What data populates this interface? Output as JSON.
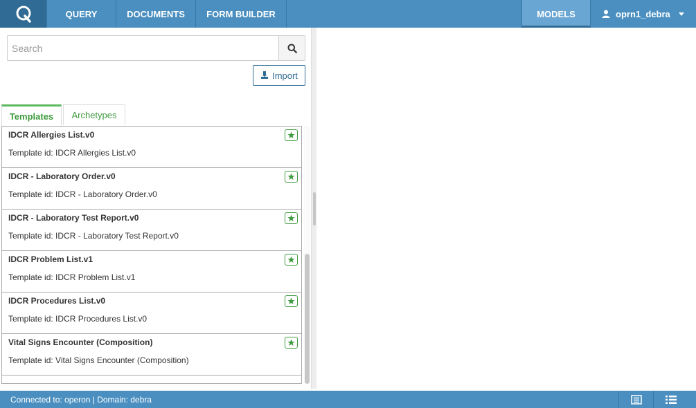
{
  "nav": {
    "logo_letter": "Q",
    "items": [
      {
        "label": "QUERY"
      },
      {
        "label": "DOCUMENTS"
      },
      {
        "label": "FORM BUILDER"
      }
    ],
    "models": "MODELS",
    "user": "oprn1_debra"
  },
  "search": {
    "placeholder": "Search",
    "value": ""
  },
  "import_label": "Import",
  "tabs": [
    {
      "label": "Templates",
      "active": true
    },
    {
      "label": "Archetypes",
      "active": false
    }
  ],
  "templates": [
    {
      "title": "IDCR Allergies List.v0",
      "sub": "Template id: IDCR Allergies List.v0"
    },
    {
      "title": "IDCR - Laboratory Order.v0",
      "sub": "Template id: IDCR - Laboratory Order.v0"
    },
    {
      "title": "IDCR - Laboratory Test Report.v0",
      "sub": "Template id: IDCR - Laboratory Test Report.v0"
    },
    {
      "title": "IDCR Problem List.v1",
      "sub": "Template id: IDCR Problem List.v1"
    },
    {
      "title": "IDCR Procedures List.v0",
      "sub": "Template id: IDCR Procedures List.v0"
    },
    {
      "title": "Vital Signs Encounter (Composition)",
      "sub": "Template id: Vital Signs Encounter (Composition)"
    }
  ],
  "status": {
    "text": "Connected to: operon | Domain: debra"
  },
  "icons": {
    "search": "search-icon",
    "import": "import-icon",
    "star": "star-icon",
    "user": "user-icon",
    "status_left": "document-list-icon",
    "status_right": "list-icon"
  },
  "colors": {
    "nav_bg": "#4a8fc0",
    "logo_bg": "#2f6b94",
    "active_nav": "#6aa6d3",
    "tab_accent": "#5cb85c",
    "star_green": "#3f9a3f",
    "import_blue": "#2f6b94"
  }
}
